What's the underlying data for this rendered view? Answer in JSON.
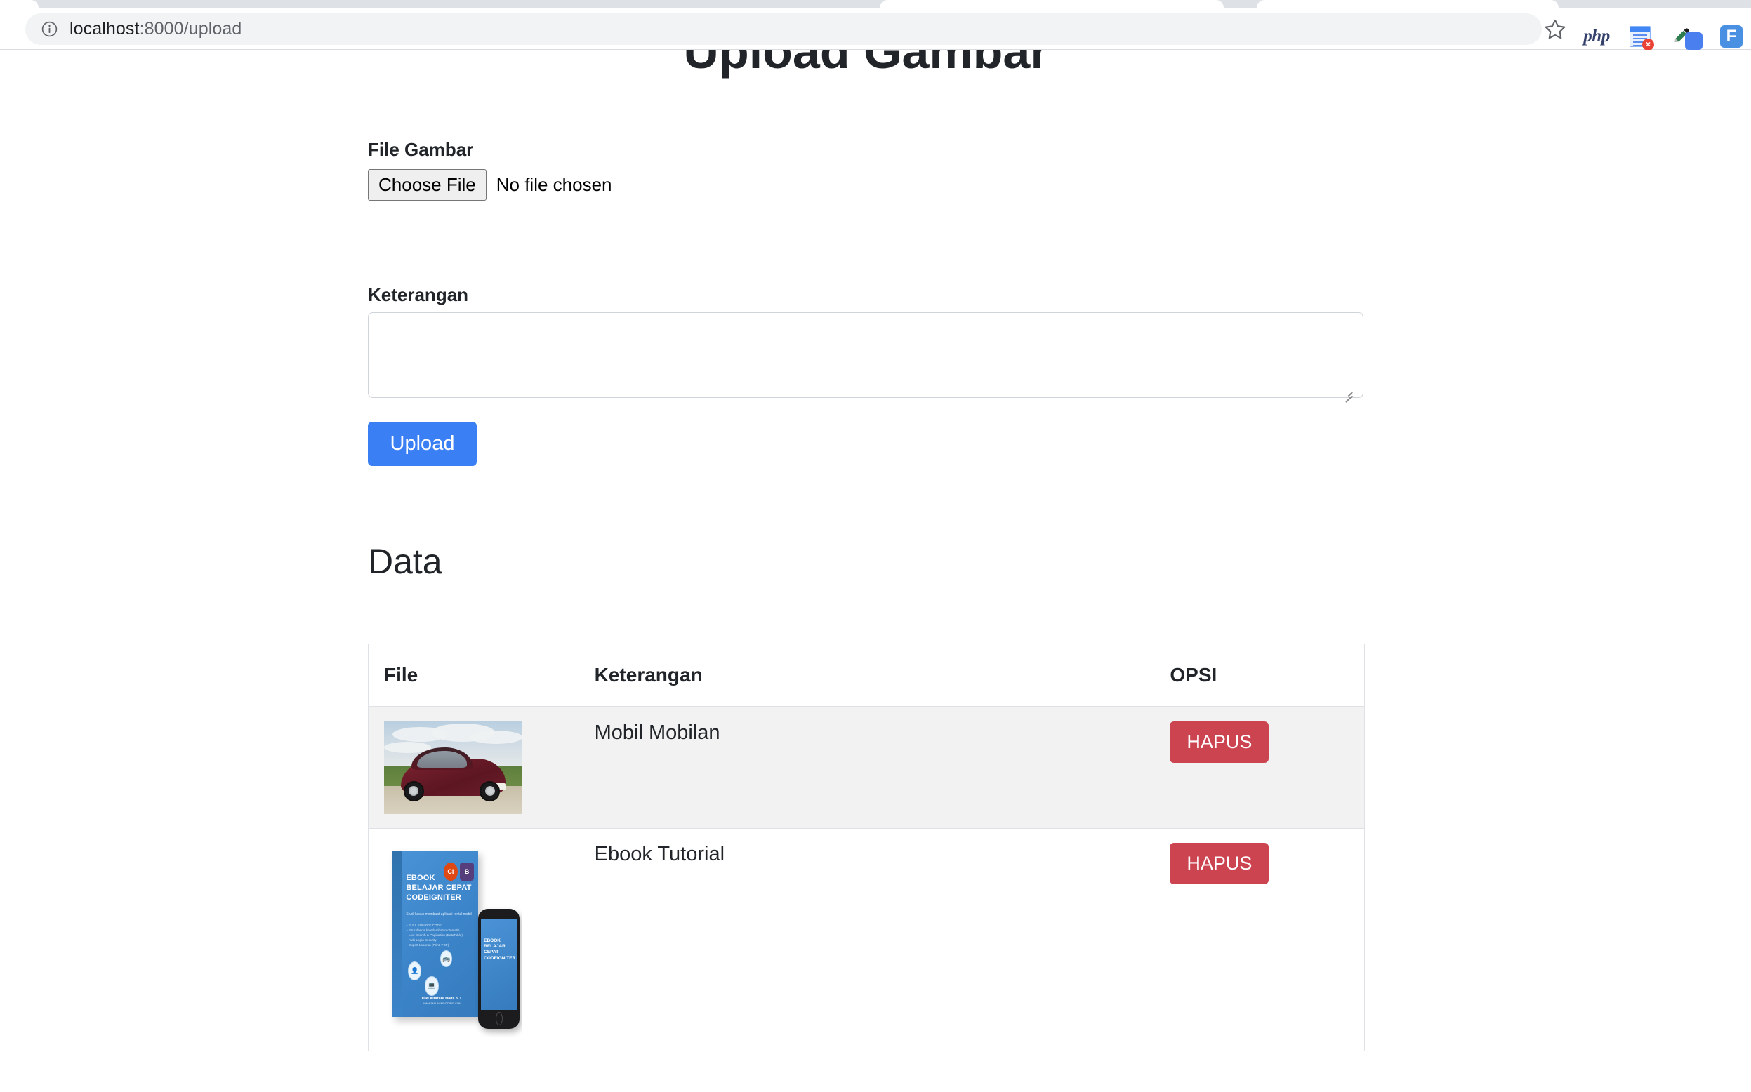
{
  "browser": {
    "url_host": "localhost",
    "url_path": ":8000/upload",
    "info_icon": "info-circle-icon",
    "bookmark_icon": "star-icon",
    "extensions": [
      {
        "name": "php-extension-icon",
        "label": "php"
      },
      {
        "name": "form-filler-extension-icon",
        "label": "",
        "badge": "×"
      },
      {
        "name": "color-picker-extension-icon",
        "label": ""
      },
      {
        "name": "figma-extension-icon",
        "label": "F"
      }
    ]
  },
  "page": {
    "title": "Upload Gambar",
    "form": {
      "file_label": "File Gambar",
      "choose_file_button": "Choose File",
      "no_file_text": "No file chosen",
      "keterangan_label": "Keterangan",
      "keterangan_value": "",
      "keterangan_placeholder": "",
      "submit_button": "Upload",
      "submit_color": "#3b7ff5"
    },
    "data_heading": "Data",
    "table": {
      "columns": [
        "File",
        "Keterangan",
        "OPSI"
      ],
      "delete_button": "HAPUS",
      "delete_color": "#cb4450",
      "rows": [
        {
          "thumbnail": "car-photo-thumbnail",
          "thumbnail_alt": "Dark red Fiat 500 parked on gravel road",
          "keterangan": "Mobil Mobilan",
          "action": "HAPUS"
        },
        {
          "thumbnail": "ebook-cover-thumbnail",
          "thumbnail_alt": "Ebook Belajar Cepat CodeIgniter cover with phone mockup",
          "keterangan": "Ebook Tutorial",
          "action": "HAPUS",
          "cover_text": {
            "title_line1": "EBOOK",
            "title_line2": "BELAJAR CEPAT",
            "title_line3": "CODEIGNITER",
            "subtitle": "Studi kasus membuat aplikasi rental mobil",
            "bullets": [
              "+ FULL SOURCE CODE",
              "+ Fitur denda keterlambatan otomatis",
              "+ Live Search & Pagination (DataTable)",
              "+ md5 Login Security",
              "+ Export Laporan (Print, PDF)"
            ],
            "author": "Diki Alfarabi Hadi, S.T.",
            "website": "WWW.MALASNGODING.COM",
            "logo_ci": "CI",
            "logo_bs": "B",
            "spine": "BELAJAR CEPAT CODEIGNITER"
          }
        }
      ]
    }
  }
}
